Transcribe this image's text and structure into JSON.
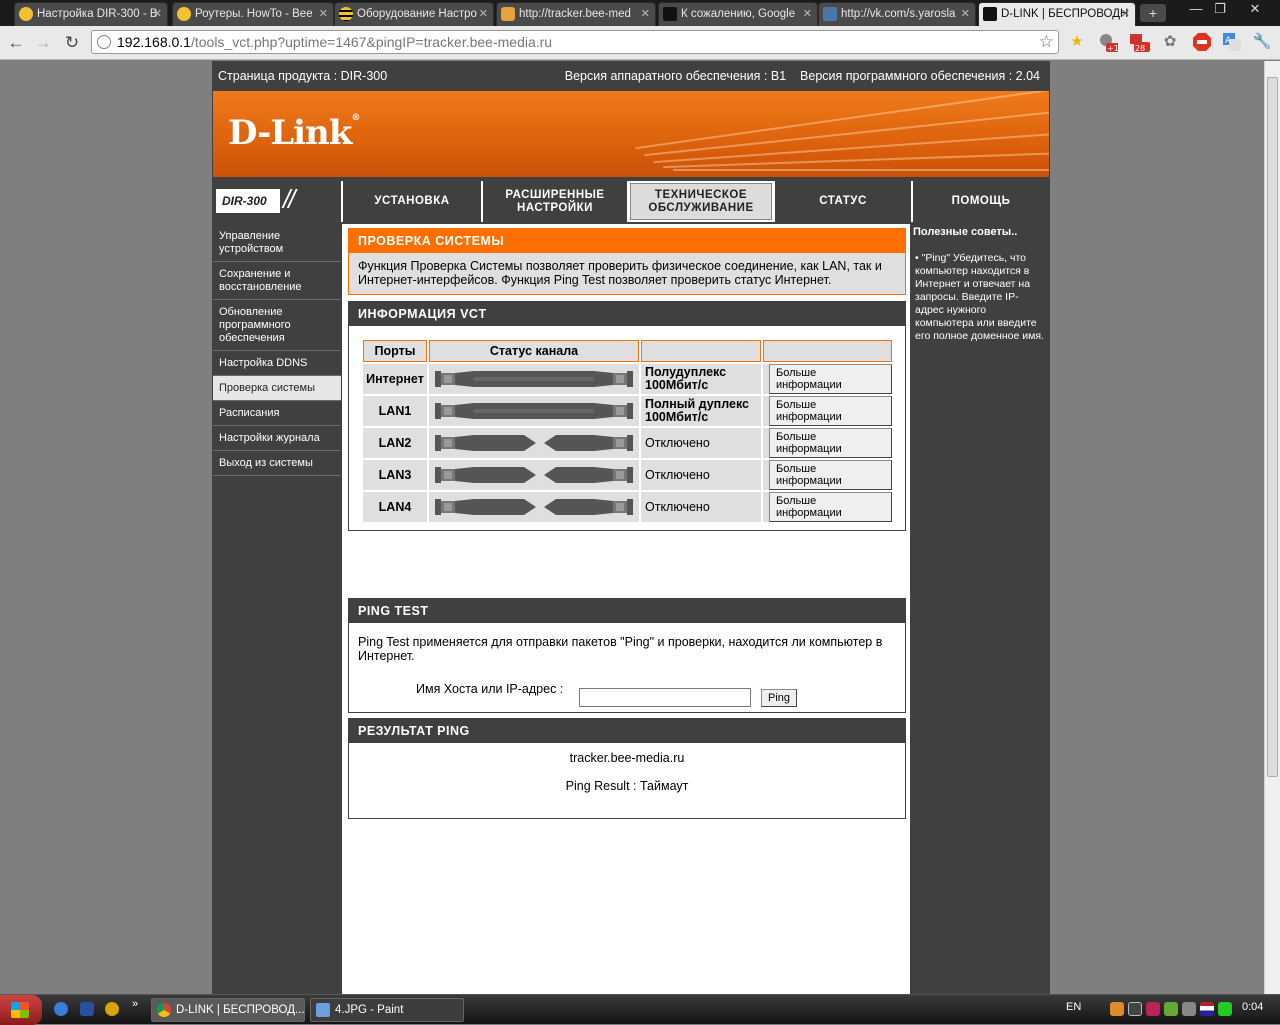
{
  "browser": {
    "tabs": [
      {
        "title": "Настройка DIR-300 - B",
        "active": false
      },
      {
        "title": "Роутеры. HowTo - Bee",
        "active": false
      },
      {
        "title": "Оборудование Настро",
        "active": false
      },
      {
        "title": "http://tracker.bee-med",
        "active": false
      },
      {
        "title": "К сожалению, Google",
        "active": false
      },
      {
        "title": "http://vk.com/s.yarosla",
        "active": false
      },
      {
        "title": "D-LINK | БЕСПРОВОДН",
        "active": true
      }
    ],
    "new_tab": "+",
    "window_controls": {
      "minimize": "—",
      "restore": "❐",
      "close": "✕"
    },
    "nav": {
      "back": "←",
      "forward": "→",
      "reload": "↻"
    },
    "url_host": "192.168.0.1",
    "url_rest": "/tools_vct.php?uptime=1467&pingIP=tracker.bee-media.ru",
    "bookmark_star": "☆",
    "extension_badges": {
      "b1": "+1",
      "b2": "28"
    }
  },
  "router": {
    "product_page_label": "Страница продукта :  DIR-300",
    "version_label": "Версия аппаратного обеспечения : B1    Версия программного обеспечения : 2.04",
    "logo": "D-Link",
    "model": "DIR-300",
    "tabs": [
      {
        "label": "УСТАНОВКА"
      },
      {
        "label": "РАСШИРЕННЫЕ\nНАСТРОЙКИ"
      },
      {
        "label": "ТЕХНИЧЕСКОЕ\nОБСЛУЖИВАНИЕ"
      },
      {
        "label": "СТАТУС"
      },
      {
        "label": "ПОМОЩЬ"
      }
    ],
    "sidebar": [
      {
        "label": "Управление устройством"
      },
      {
        "label": "Сохранение и восстановление"
      },
      {
        "label": "Обновление программного обеспечения"
      },
      {
        "label": "Настройка DDNS"
      },
      {
        "label": "Проверка системы"
      },
      {
        "label": "Расписания"
      },
      {
        "label": "Настройки журнала"
      },
      {
        "label": "Выход из системы"
      }
    ],
    "system_check": {
      "title": "ПРОВЕРКА СИСТЕМЫ",
      "desc": "Функция Проверка Системы позволяет проверить физическое соединение, как LAN, так и Интернет-интерфейсов. Функция Ping Test позволяет проверить статус Интернет."
    },
    "vct": {
      "title": "ИНФОРМАЦИЯ VCT",
      "headers": [
        "Порты",
        "Статус канала",
        "",
        ""
      ],
      "rows": [
        {
          "port": "Интернет",
          "connected": true,
          "status": "Полудуплекс 100Мбит/с",
          "button": "Больше информации"
        },
        {
          "port": "LAN1",
          "connected": true,
          "status": "Полный дуплекс 100Мбит/с",
          "button": "Больше информации"
        },
        {
          "port": "LAN2",
          "connected": false,
          "status": "Отключено",
          "button": "Больше информации"
        },
        {
          "port": "LAN3",
          "connected": false,
          "status": "Отключено",
          "button": "Больше информации"
        },
        {
          "port": "LAN4",
          "connected": false,
          "status": "Отключено",
          "button": "Больше информации"
        }
      ]
    },
    "ping_test": {
      "title": "PING TEST",
      "desc": "Ping Test применяется для отправки пакетов \"Ping\" и проверки, находится ли компьютер в Интернет.",
      "host_label": "Имя Хоста или IP-адрес :",
      "host_value": "",
      "button": "Ping"
    },
    "ping_result": {
      "title": "РЕЗУЛЬТАТ PING",
      "host": "tracker.bee-media.ru",
      "result": "Ping Result : Таймаут"
    },
    "tips": {
      "title": "Полезные советы..",
      "text": "• \"Ping\" Убедитесь, что компьютер находится в Интернет и отвечает на запросы. Введите IP-адрес нужного компьютера или введите его полное доменное имя."
    }
  },
  "taskbar": {
    "tasks": [
      {
        "label": "D-LINK | БЕСПРОВОД...",
        "active": true
      },
      {
        "label": "4.JPG - Paint",
        "active": false
      }
    ],
    "lang": "EN",
    "clock": "0:04"
  }
}
